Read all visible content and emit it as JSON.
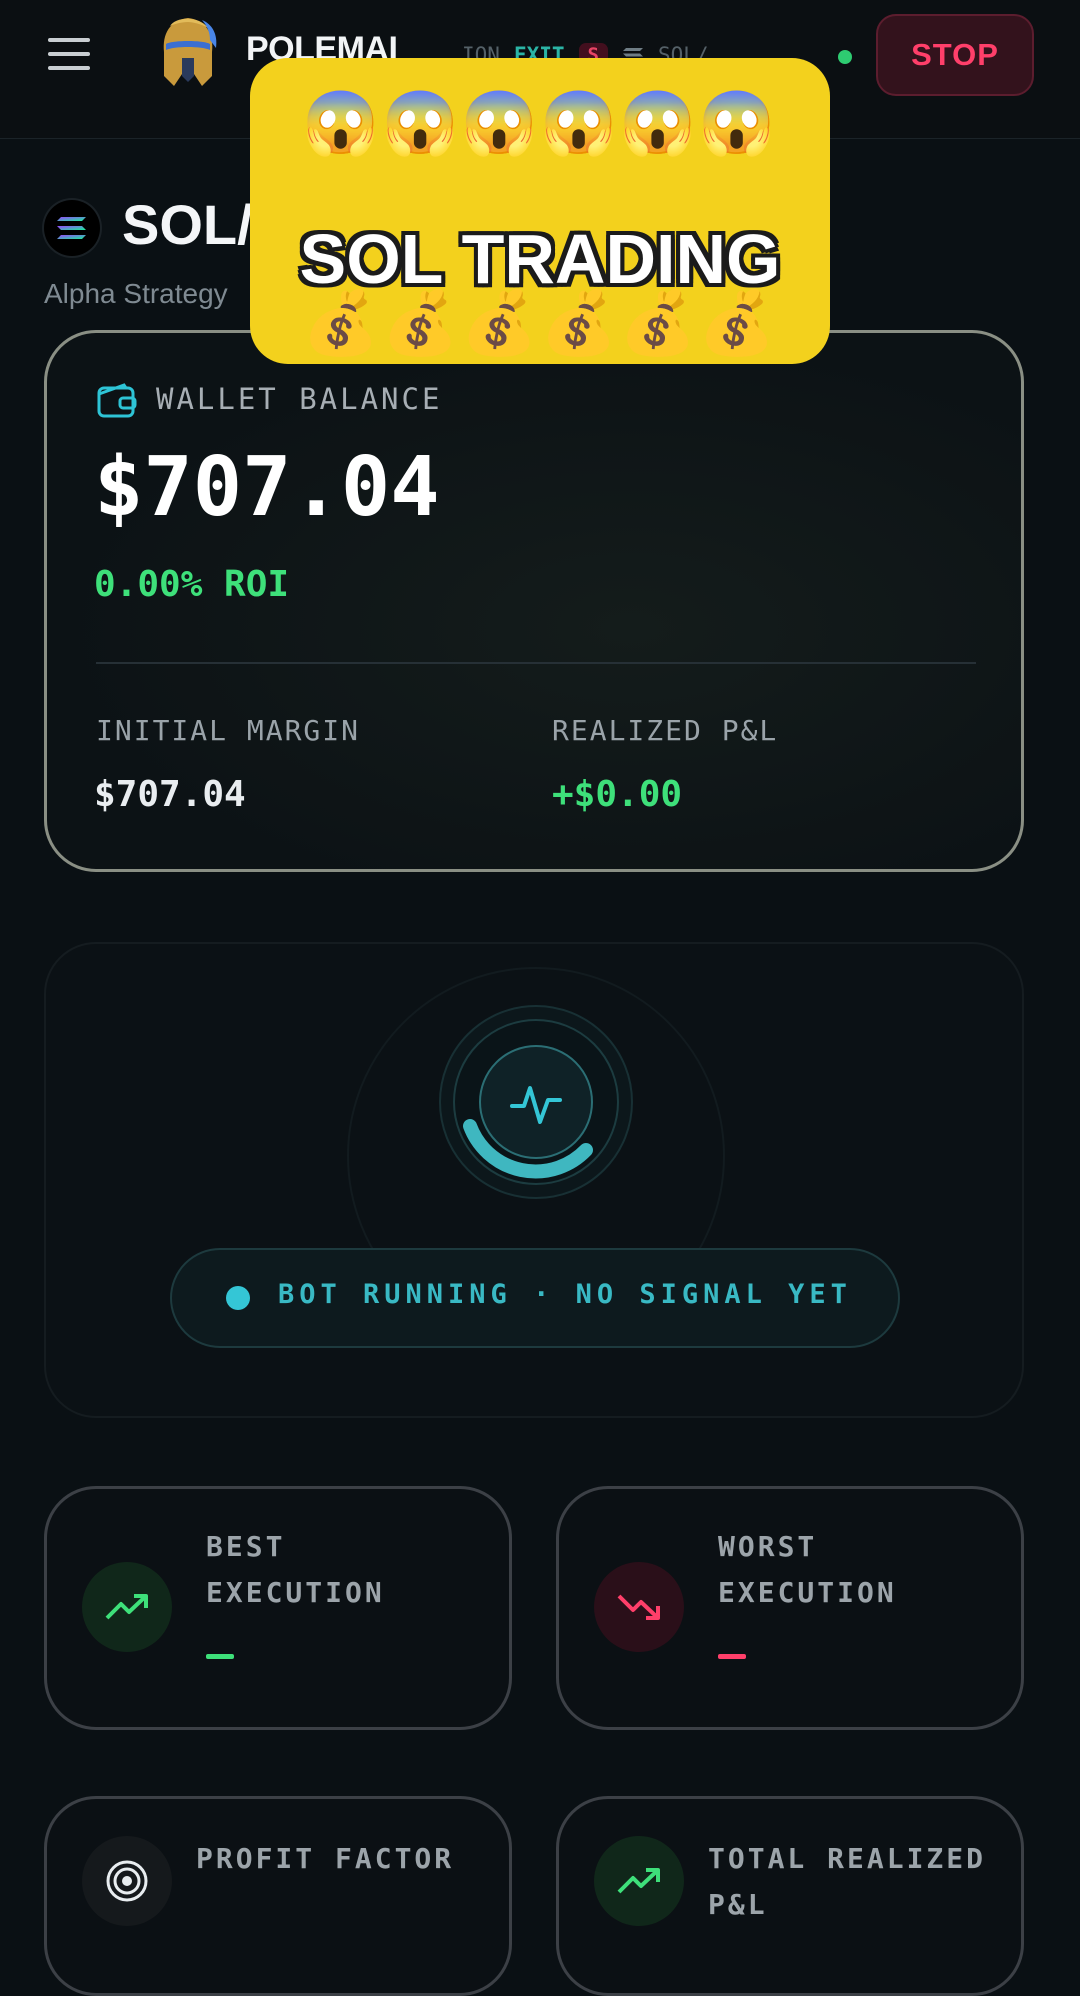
{
  "topbar": {
    "brand": "POLEMAI",
    "ticker": {
      "prefix": "ION",
      "exit_label": "EXIT",
      "side_badge": "S",
      "symbol": "SOL/..."
    },
    "stop_label": "STOP"
  },
  "header": {
    "pair": "SOL/USDT",
    "strategy": "Alpha Strategy"
  },
  "overlay": {
    "emoji_top": "😱😱😱😱😱😱",
    "title": "SOL TRADING",
    "emoji_bottom": "💰💰💰💰💰💰"
  },
  "wallet": {
    "label": "WALLET BALANCE",
    "balance": "$707.04",
    "roi": "0.00% ROI",
    "initial_margin_label": "INITIAL MARGIN",
    "initial_margin_value": "$707.04",
    "realized_pnl_label": "REALIZED P&L",
    "realized_pnl_value": "+$0.00"
  },
  "bot": {
    "status": "BOT RUNNING · NO SIGNAL YET"
  },
  "stats": {
    "best": {
      "label_line1": "BEST",
      "label_line2": "EXECUTION"
    },
    "worst": {
      "label_line1": "WORST",
      "label_line2": "EXECUTION"
    },
    "profit_factor": {
      "label": "PROFIT FACTOR"
    },
    "total_pnl": {
      "label_line1": "TOTAL REALIZED",
      "label_line2": "P&L"
    }
  },
  "colors": {
    "accent_green": "#3ee07a",
    "accent_teal": "#34c6d6",
    "danger": "#ff3f6a",
    "sticker_yellow": "#f3d11d"
  }
}
